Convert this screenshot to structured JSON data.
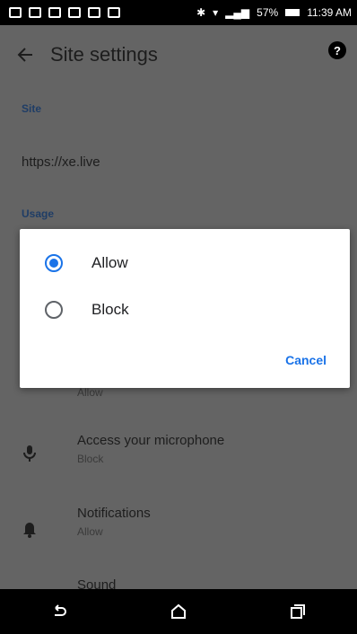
{
  "status_bar": {
    "battery": "57%",
    "time": "11:39 AM"
  },
  "app_bar": {
    "title": "Site settings",
    "help_glyph": "?"
  },
  "site_section": {
    "label": "Site",
    "url": "https://xe.live"
  },
  "usage_section": {
    "label": "Usage"
  },
  "settings": [
    {
      "title": "",
      "value": "Allow",
      "icon": "location-icon"
    },
    {
      "title": "Access your microphone",
      "value": "Block",
      "icon": "microphone-icon"
    },
    {
      "title": "Notifications",
      "value": "Allow",
      "icon": "bell-icon"
    },
    {
      "title": "Sound",
      "value": "",
      "icon": "speaker-icon"
    }
  ],
  "dialog": {
    "options": [
      {
        "label": "Allow",
        "selected": true
      },
      {
        "label": "Block",
        "selected": false
      }
    ],
    "cancel_label": "Cancel"
  },
  "colors": {
    "accent": "#1a73e8",
    "scrim": "#646464",
    "section_label": "#1f3d66"
  }
}
